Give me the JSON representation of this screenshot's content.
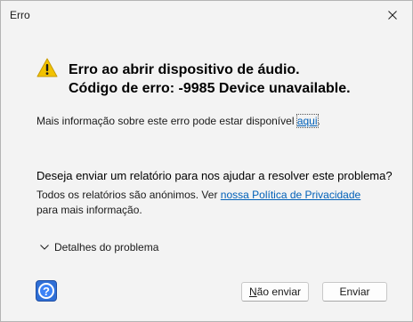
{
  "window": {
    "title": "Erro"
  },
  "error": {
    "heading_line1": "Erro ao abrir dispositivo de áudio.",
    "heading_line2": "Código de erro: -9985 Device unavailable.",
    "info_text": "Mais informação sobre este erro pode estar disponível ",
    "info_link": "aqui",
    "info_suffix": "."
  },
  "report": {
    "question": "Deseja enviar um relatório para nos ajudar a resolver este problema?",
    "anon_text": "Todos os relatórios são anónimos. Ver ",
    "privacy_link": "nossa Política de Privacidade",
    "anon_suffix": " para mais informação."
  },
  "details": {
    "label": "Detalhes do problema",
    "icon": "chevron-down-icon"
  },
  "buttons": {
    "help_glyph": "?",
    "no_send_first": "N",
    "no_send_rest": "ão enviar",
    "send": "Enviar"
  },
  "icons": {
    "warning": "warning-triangle-icon",
    "close": "close-icon",
    "help": "help-icon"
  },
  "colors": {
    "link": "#0060b8",
    "warning": "#f2c200",
    "help_button": "#2f6fd6"
  }
}
